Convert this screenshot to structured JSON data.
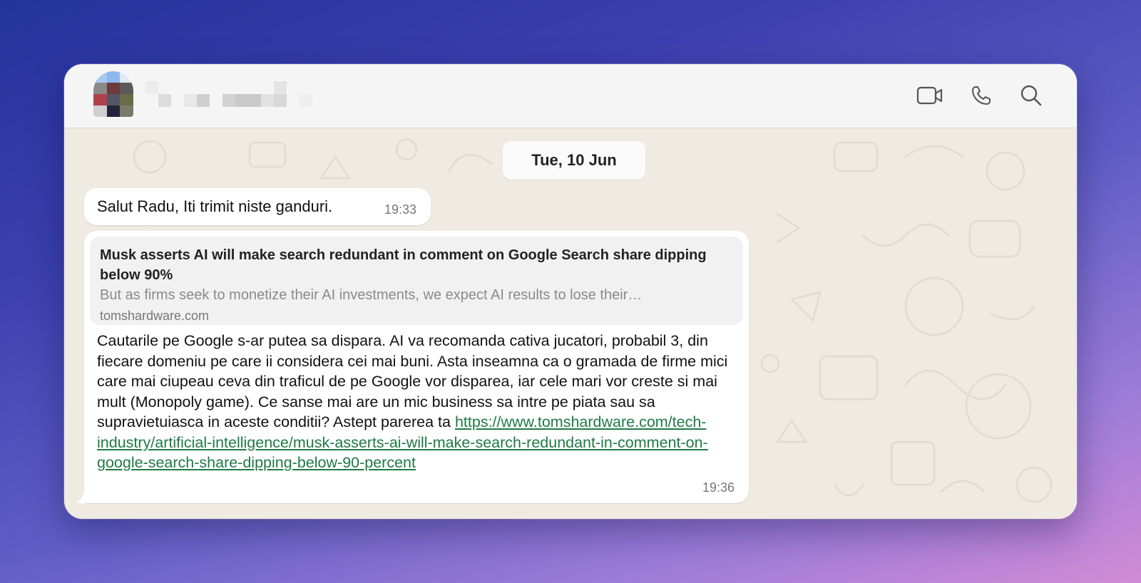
{
  "header": {
    "video_icon": "video-camera-icon",
    "call_icon": "phone-icon",
    "search_icon": "search-icon"
  },
  "chat": {
    "date_separator": "Tue, 10 Jun",
    "messages": [
      {
        "text": "Salut Radu, Iti trimit niste ganduri.",
        "time": "19:33"
      },
      {
        "link_preview": {
          "title": "Musk asserts AI will make search redundant in comment on Google Search share dipping below 90%",
          "description": "But as firms seek to monetize their AI investments, we expect AI results to lose their…",
          "domain": "tomshardware.com"
        },
        "text": "Cautarile pe Google s-ar putea sa dispara. AI va recomanda cativa jucatori, probabil 3, din fiecare domeniu pe care ii considera cei mai buni. Asta inseamna ca o gramada de firme mici care mai ciupeau ceva din traficul de pe Google vor disparea, iar cele mari vor creste si mai mult (Monopoly game). Ce sanse mai are un mic business sa intre pe piata sau sa supravietuiasca in aceste conditii? Astept parerea ta ",
        "link": "https://www.tomshardware.com/tech-industry/artificial-intelligence/musk-asserts-ai-will-make-search-redundant-in-comment-on-google-search-share-dipping-below-90-percent",
        "time": "19:36"
      }
    ]
  },
  "colors": {
    "chat_background": "#efeae2",
    "bubble": "#ffffff",
    "link": "#1f7a45",
    "header": "#f5f5f5"
  }
}
